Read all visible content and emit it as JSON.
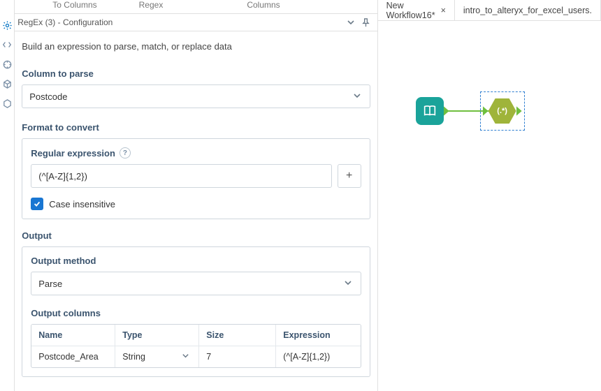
{
  "tool_tabs": {
    "left": "To Columns",
    "mid": "Regex",
    "right": "Columns"
  },
  "panel": {
    "title": "RegEx (3) - Configuration",
    "intro": "Build an expression to parse, match, or replace data",
    "column_section": "Column to parse",
    "column_value": "Postcode",
    "format_section": "Format to convert",
    "regex_label": "Regular expression",
    "regex_value": "(^[A-Z]{1,2})",
    "case_label": "Case insensitive",
    "output_section": "Output",
    "output_method_label": "Output method",
    "output_method_value": "Parse",
    "output_columns_label": "Output columns",
    "grid": {
      "headers": {
        "name": "Name",
        "type": "Type",
        "size": "Size",
        "expr": "Expression"
      },
      "row": {
        "name": "Postcode_Area",
        "type": "String",
        "size": "7",
        "expr": "(^[A-Z]{1,2})"
      }
    }
  },
  "canvas": {
    "tabs": [
      {
        "label": "New Workflow16*",
        "closable": true
      },
      {
        "label": "intro_to_alteryx_for_excel_users.",
        "closable": false
      }
    ],
    "nodes": {
      "input": "book-icon",
      "regex": "regex-icon",
      "regex_label": "(.*)"
    }
  }
}
